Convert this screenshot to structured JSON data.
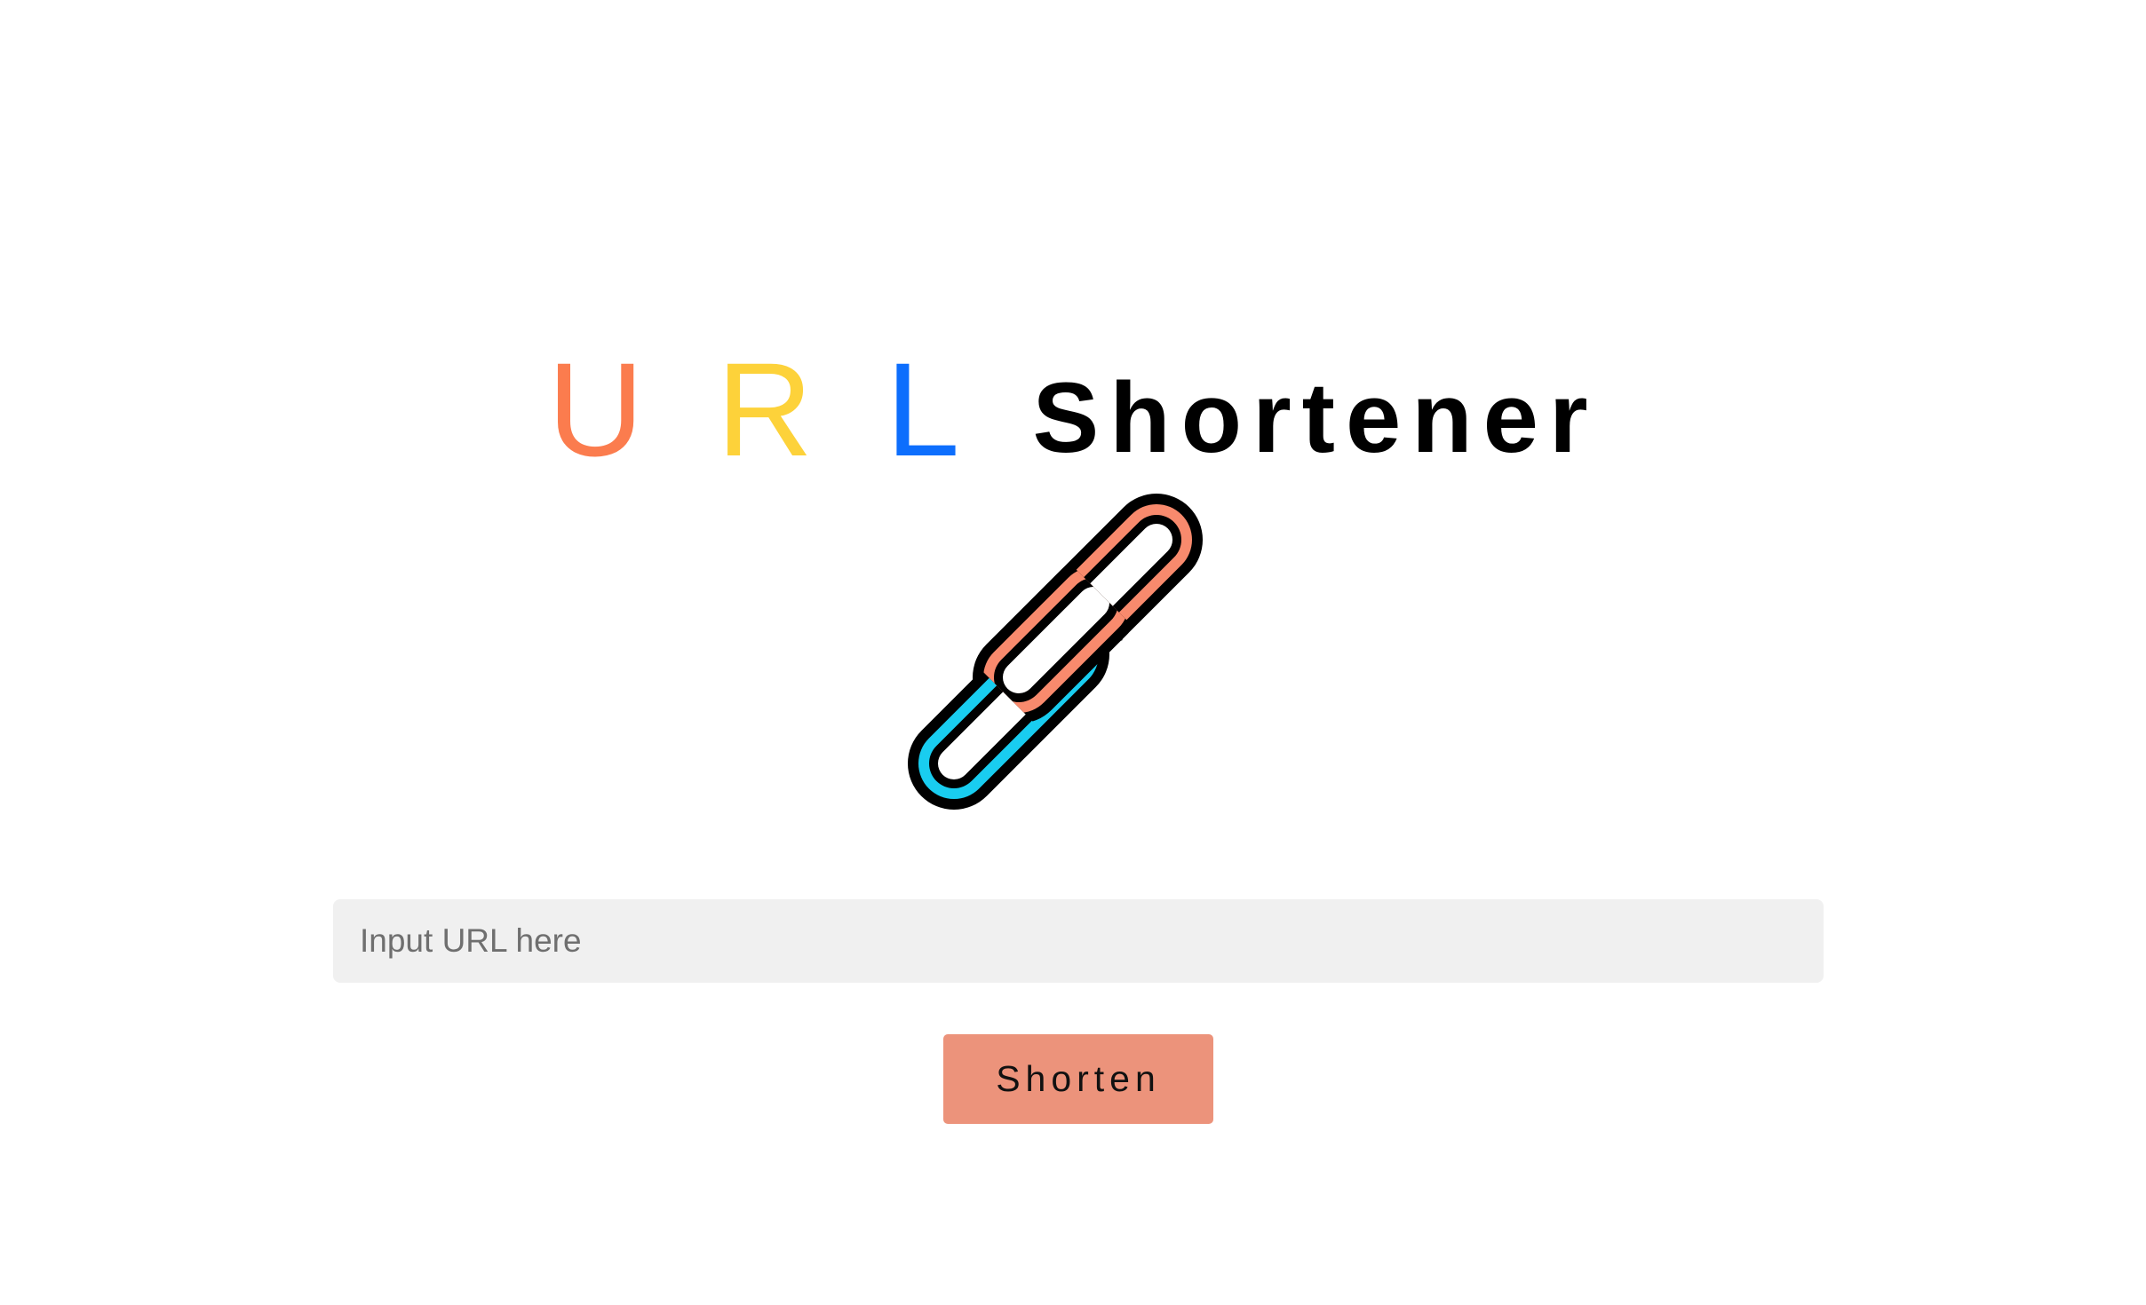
{
  "header": {
    "letters": [
      {
        "text": "U",
        "color": "#fb7c4e"
      },
      {
        "text": "R",
        "color": "#fdd23a"
      },
      {
        "text": "L",
        "color": "#0d6efd"
      }
    ],
    "word": "Shortener"
  },
  "logo": {
    "icon": "chain-link-icon",
    "colors": {
      "link_top": "#f88a6d",
      "link_bottom": "#19cdf0",
      "outline": "#000000"
    }
  },
  "form": {
    "url_placeholder": "Input URL here",
    "url_value": "",
    "submit_label": "Shorten",
    "submit_color": "#ec937b"
  }
}
